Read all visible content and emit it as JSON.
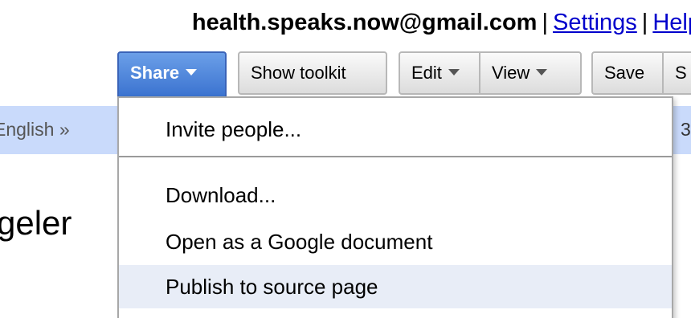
{
  "header": {
    "email": "health.speaks.now@gmail.com",
    "separator": "|",
    "settings_link": "Settings",
    "help_link": "Help"
  },
  "toolbar": {
    "share_label": "Share",
    "show_toolkit_label": "Show toolkit",
    "edit_label": "Edit",
    "view_label": "View",
    "save_label": "Save",
    "s_label": "S"
  },
  "background": {
    "language_text": "English »",
    "right_fragment": "3",
    "heading_fragment": "geler"
  },
  "share_menu": {
    "items": [
      "Invite people...",
      "Download...",
      "Open as a Google document",
      "Publish to source page"
    ]
  },
  "colors": {
    "share_accent": "#3b73d0",
    "link": "#0000cc",
    "language_bar": "#c9dafb",
    "highlight": "#e8edf7"
  }
}
